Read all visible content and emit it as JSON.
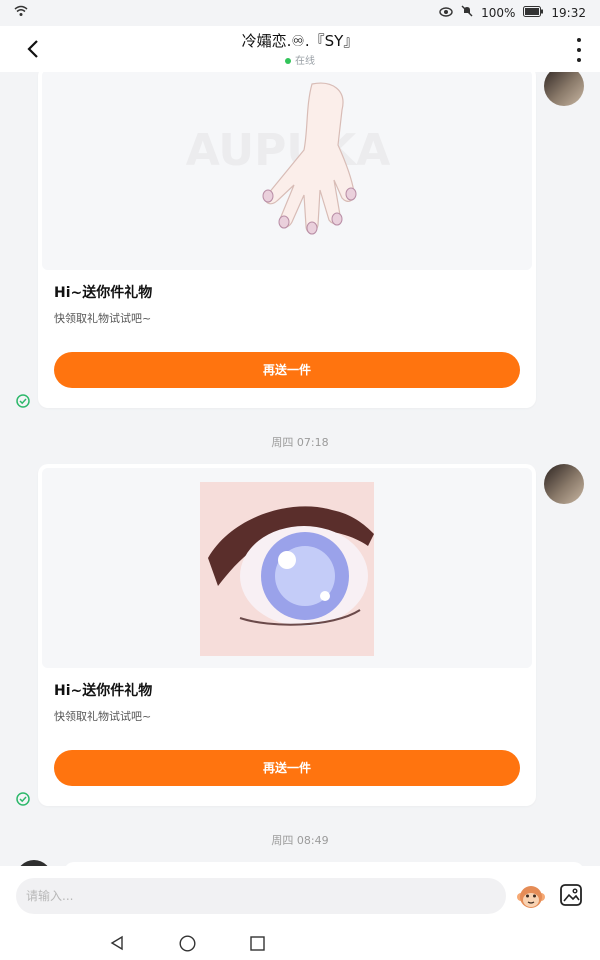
{
  "status": {
    "signal_icon": "wifi-icon",
    "battery_percent": "100%",
    "clock": "19:32",
    "icons": [
      "eye-icon",
      "mute-icon",
      "battery-icon"
    ]
  },
  "header": {
    "title": "冷孀恋.♾.『SY』",
    "online": "在线"
  },
  "messages": [
    {
      "gift_title": "Hi~送你件礼物",
      "gift_sub": "快领取礼物试试吧~",
      "button": "再送一件"
    },
    {
      "timestamp": "周四 07:18"
    },
    {
      "gift_title": "Hi~送你件礼物",
      "gift_sub": "快领取礼物试试吧~",
      "button": "再送一件"
    },
    {
      "timestamp": "周四 08:49"
    }
  ],
  "composer": {
    "placeholder": "请输入..."
  },
  "nav": {
    "icons": [
      "back-triangle-icon",
      "home-circle-icon",
      "recent-square-icon"
    ]
  },
  "colors": {
    "accent": "#ff740f",
    "online": "#32c45a"
  }
}
